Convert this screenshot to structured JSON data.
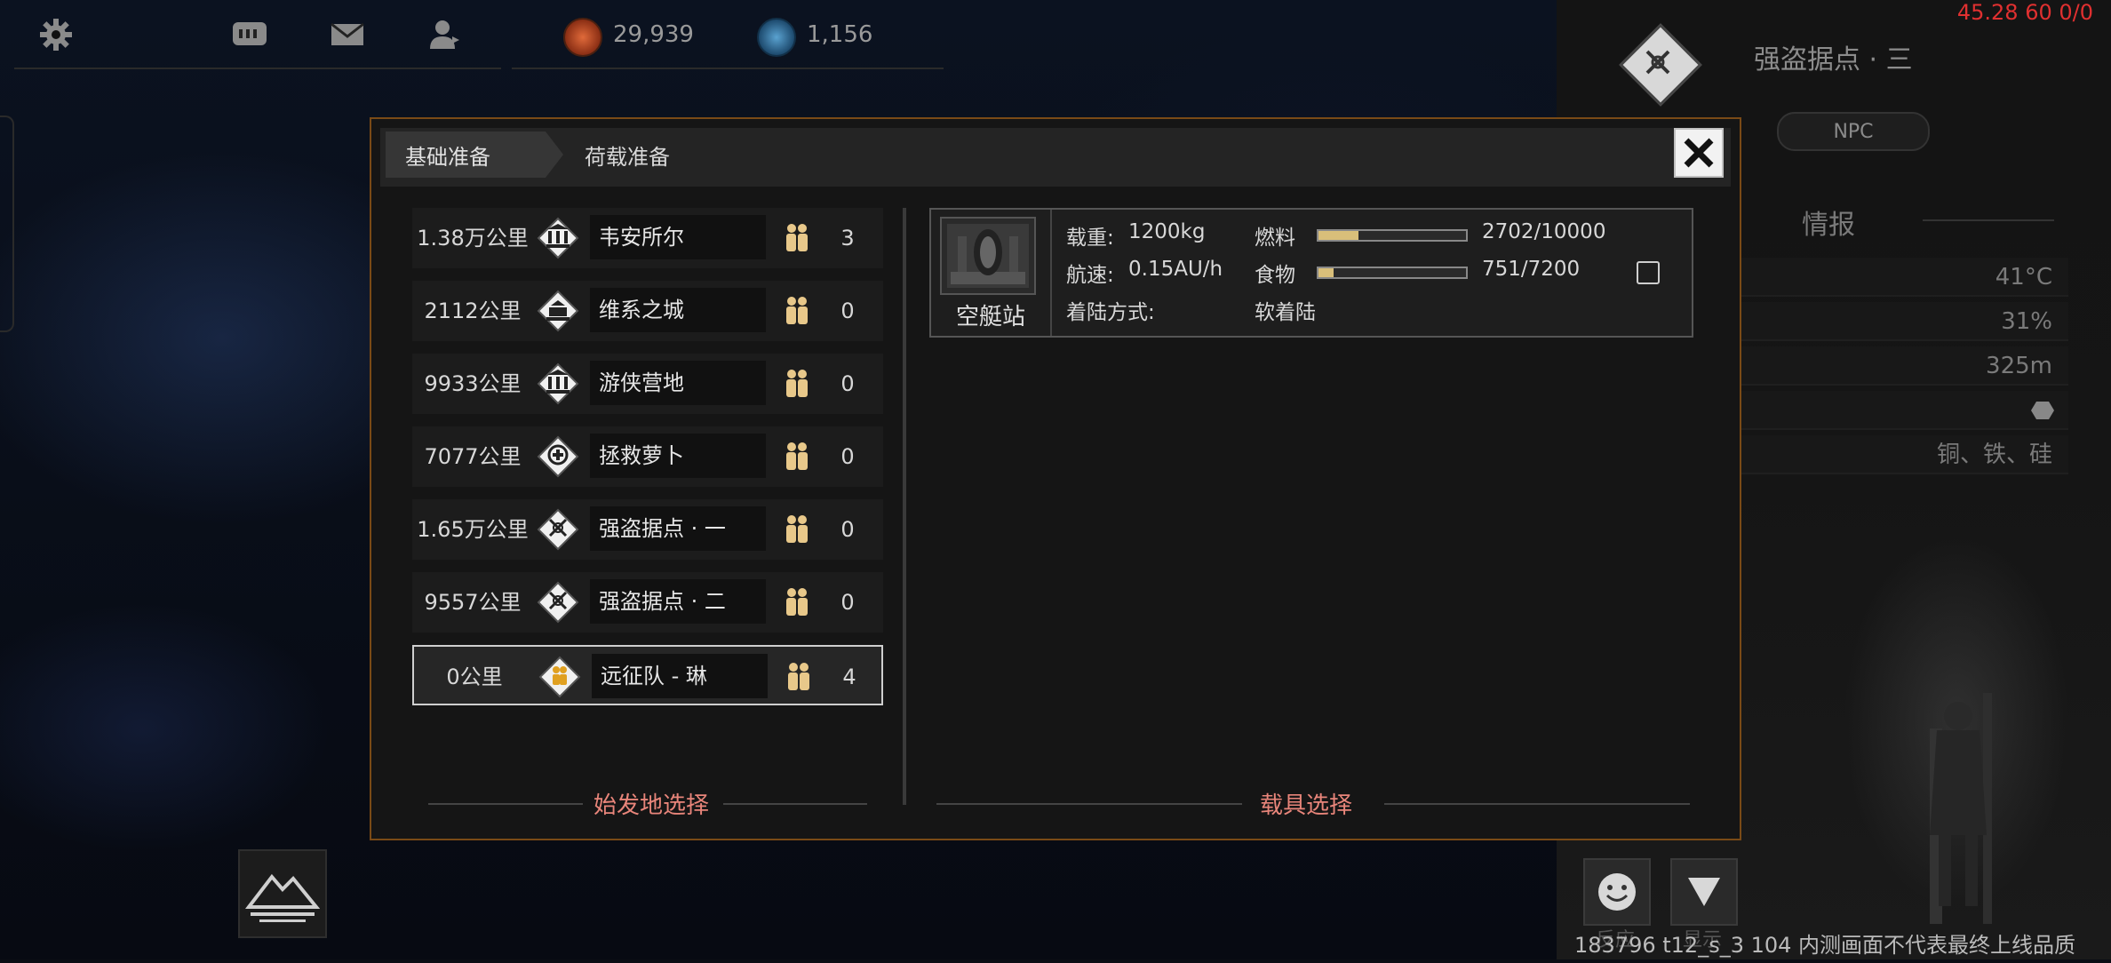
{
  "topbar": {
    "icons": [
      "gear-icon",
      "chat-icon",
      "mail-icon",
      "profile-icon"
    ],
    "resources": [
      {
        "icon": "red-resource-icon",
        "value": "29,939",
        "color": "#c0502a"
      },
      {
        "icon": "blue-resource-icon",
        "value": "1,156",
        "color": "#3a7aa6"
      }
    ]
  },
  "debug": {
    "fps": "45.28 60 0/0",
    "build": "183796 t12_s_3 104  内测画面不代表最终上线品质"
  },
  "right_panel": {
    "title": "强盗据点 · 三",
    "badge": "NPC",
    "section": "情报",
    "rows": [
      "41°C",
      "31%",
      "325m",
      "",
      "铜、铁、硅"
    ],
    "buttons": [
      {
        "icon": "smile-icon",
        "label": "反应"
      },
      {
        "icon": "triangle-down-icon",
        "label": "显示"
      }
    ]
  },
  "dialog": {
    "tabs": [
      "基础准备",
      "荷载准备"
    ],
    "origin_section": "始发地选择",
    "vehicle_section": "载具选择",
    "locations": [
      {
        "distance": "1.38万公里",
        "icon": "building-icon",
        "name": "韦安所尔",
        "people": "3",
        "selected": false
      },
      {
        "distance": "2112公里",
        "icon": "city-icon",
        "name": "维系之城",
        "people": "0",
        "selected": false
      },
      {
        "distance": "9933公里",
        "icon": "building-icon",
        "name": "游侠营地",
        "people": "0",
        "selected": false
      },
      {
        "distance": "7077公里",
        "icon": "rescue-icon",
        "name": "拯救萝卜",
        "people": "0",
        "selected": false
      },
      {
        "distance": "1.65万公里",
        "icon": "crossed-swords-icon",
        "name": "强盗据点 · 一",
        "people": "0",
        "selected": false
      },
      {
        "distance": "9557公里",
        "icon": "crossed-swords-icon",
        "name": "强盗据点 · 二",
        "people": "0",
        "selected": false
      },
      {
        "distance": "0公里",
        "icon": "expedition-icon",
        "name": "远征队 - 琳",
        "people": "4",
        "selected": true
      }
    ],
    "vehicle": {
      "name": "空艇站",
      "load_label": "载重:",
      "load_value": "1200kg",
      "speed_label": "航速:",
      "speed_value": "0.15AU/h",
      "landing_label": "着陆方式:",
      "landing_value": "软着陆",
      "fuel_label": "燃料",
      "fuel_value": "2702/10000",
      "fuel_fraction": 0.27,
      "food_label": "食物",
      "food_value": "751/7200",
      "food_fraction": 0.104,
      "checked": false
    }
  }
}
